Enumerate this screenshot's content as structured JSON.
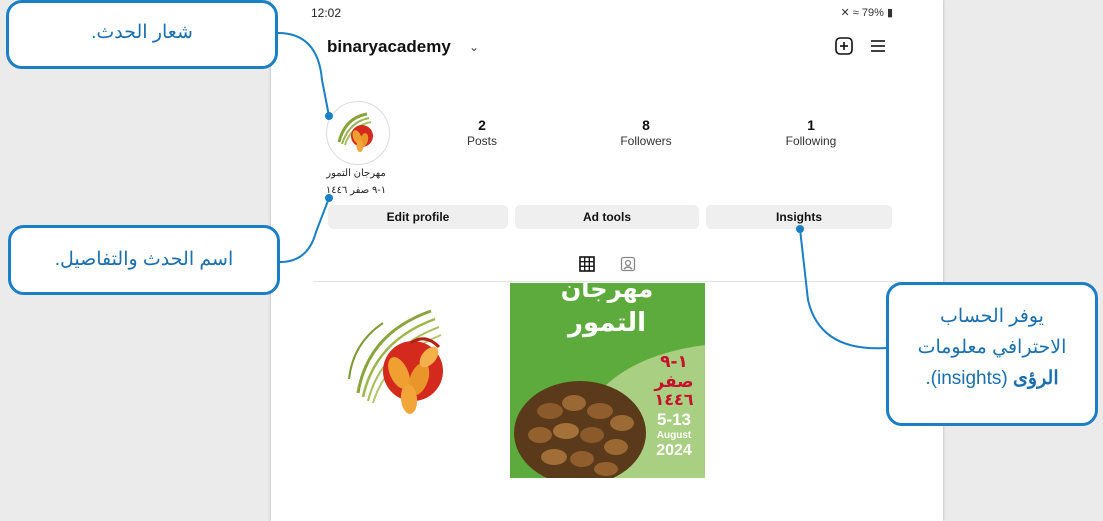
{
  "status_bar": {
    "time": "12:02",
    "battery": "79%"
  },
  "profile": {
    "username": "binaryacademy",
    "stats": [
      {
        "value": "2",
        "label": "Posts"
      },
      {
        "value": "8",
        "label": "Followers"
      },
      {
        "value": "1",
        "label": "Following"
      }
    ],
    "bio_name": "مهرجان التمور",
    "bio_details": "١-٩ صفر ١٤٤٦",
    "buttons": [
      "Edit profile",
      "Ad tools",
      "Insights"
    ]
  },
  "post2": {
    "title_line1": "مهرجان",
    "title_line2": "التمور",
    "date_ar_1": "١-٩",
    "date_ar_2": "صفر",
    "date_ar_3": "١٤٤٦",
    "date_en_1": "5-13",
    "date_en_2": "August",
    "date_en_3": "2024"
  },
  "callouts": {
    "logo": "شعار الحدث.",
    "name": "اسم الحدث والتفاصيل.",
    "insights_line1": "يوفر الحساب",
    "insights_line2": "الاحترافي معلومات",
    "insights_bold": "الرؤى",
    "insights_rest": " (insights)."
  },
  "colors": {
    "accent": "#1a7fc4",
    "green": "#5cab3c",
    "red": "#d42a1e"
  }
}
